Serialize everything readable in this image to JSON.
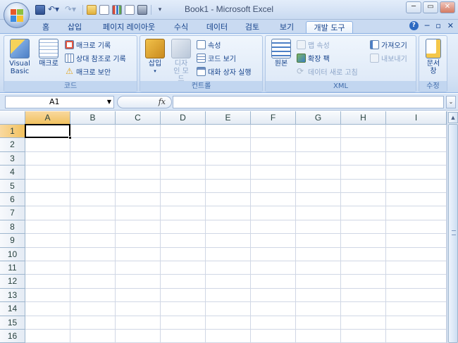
{
  "window": {
    "title": "Book1 - Microsoft Excel",
    "controls": {
      "minimize": "─",
      "restore": "▭",
      "close": "✕"
    }
  },
  "quick_access": {
    "icons": [
      "save-icon",
      "undo-icon",
      "redo-icon",
      "open-icon",
      "print-preview-icon",
      "chart-icon",
      "new-icon",
      "camera-icon",
      "customize-icon"
    ]
  },
  "tabs": [
    {
      "label": "홈",
      "active": false
    },
    {
      "label": "삽입",
      "active": false
    },
    {
      "label": "페이지 레이아웃",
      "active": false
    },
    {
      "label": "수식",
      "active": false
    },
    {
      "label": "데이터",
      "active": false
    },
    {
      "label": "검토",
      "active": false
    },
    {
      "label": "보기",
      "active": false
    },
    {
      "label": "개발 도구",
      "active": true
    }
  ],
  "tab_right": {
    "help": "?",
    "minimize": "─",
    "restore": "▫",
    "close": "✕"
  },
  "ribbon": {
    "code": {
      "title": "코드",
      "visual_basic": "Visual Basic",
      "macro": "매크로",
      "record_macro": "매크로 기록",
      "relative_ref": "상대 참조로 기록",
      "macro_security": "매크로 보안"
    },
    "controls": {
      "title": "컨트롤",
      "insert": "삽입",
      "design_mode": "디자인 모드",
      "properties": "속성",
      "view_code": "코드 보기",
      "run_dialog": "대화 상자 실행"
    },
    "xml": {
      "title": "XML",
      "source": "원본",
      "map_properties": "맵 속성",
      "expansion_packs": "확장 팩",
      "refresh_data": "데이터 새로 고침",
      "import": "가져오기",
      "export": "내보내기"
    },
    "modify": {
      "title": "수정",
      "document_panel": "문서 창"
    }
  },
  "formula_bar": {
    "name_box": "A1",
    "fx": "fx",
    "content": ""
  },
  "sheet": {
    "columns": [
      "A",
      "B",
      "C",
      "D",
      "E",
      "F",
      "G",
      "H",
      "I"
    ],
    "rows": [
      "1",
      "2",
      "3",
      "4",
      "5",
      "6",
      "7",
      "8",
      "9",
      "10",
      "11",
      "12",
      "13",
      "14",
      "15",
      "16"
    ],
    "active_cell": "A1"
  },
  "colors": {
    "ribbon_text": "#15428b",
    "selection_header": "#f1c15f",
    "grid_line": "#d0d7e5"
  }
}
